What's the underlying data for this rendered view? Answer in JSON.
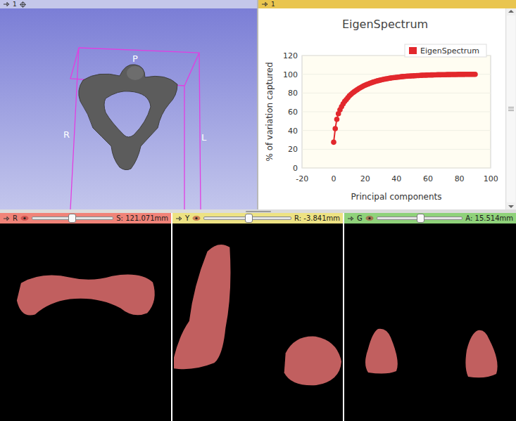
{
  "view3d": {
    "header": {
      "label": "1"
    },
    "orientation_labels": [
      {
        "text": "P"
      },
      {
        "text": "R"
      },
      {
        "text": "L"
      }
    ]
  },
  "chart_view": {
    "header": {
      "label": "1"
    },
    "title": "EigenSpectrum",
    "y_axis": {
      "label": "% of variation captured",
      "ticks": [
        "0",
        "20",
        "40",
        "60",
        "80",
        "100",
        "120"
      ]
    },
    "x_axis": {
      "label": "Principal components",
      "ticks": [
        "-20",
        "0",
        "20",
        "40",
        "60",
        "80",
        "100"
      ]
    },
    "legend": "EigenSpectrum",
    "series": [
      {
        "name": "EigenSpectrum",
        "color": "#e2282d",
        "values": [
          27.5,
          42,
          52,
          58,
          62,
          65.5,
          68.5,
          71,
          73,
          75,
          77,
          78.5,
          80,
          81.3,
          82.5,
          83.6,
          84.7,
          85.7,
          86.6,
          87.5,
          88.3,
          89,
          89.7,
          90.4,
          91,
          91.6,
          92.1,
          92.6,
          93.1,
          93.5,
          93.9,
          94.3,
          94.7,
          95,
          95.3,
          95.6,
          95.9,
          96.2,
          96.4,
          96.6,
          96.8,
          97,
          97.2,
          97.4,
          97.6,
          97.7,
          97.9,
          98,
          98.1,
          98.2,
          98.3,
          98.4,
          98.5,
          98.6,
          98.7,
          98.8,
          98.9,
          99,
          99,
          99.1,
          99.2,
          99.2,
          99.3,
          99.3,
          99.4,
          99.4,
          99.5,
          99.5,
          99.5,
          99.6,
          99.6,
          99.6,
          99.7,
          99.7,
          99.7,
          99.8,
          99.8,
          99.8,
          99.8,
          99.9,
          99.9,
          99.9,
          99.9,
          99.9,
          100,
          100,
          100,
          100,
          100,
          100,
          100
        ]
      }
    ]
  },
  "slice_views": [
    {
      "letter": "R",
      "reading": "S: 121.071mm",
      "level": 0.48,
      "color": "#f08378"
    },
    {
      "letter": "Y",
      "reading": "R: -3.841mm",
      "level": 0.5,
      "color": "#ede283"
    },
    {
      "letter": "G",
      "reading": "A: 15.514mm",
      "level": 0.5,
      "color": "#8fd27a"
    }
  ]
}
